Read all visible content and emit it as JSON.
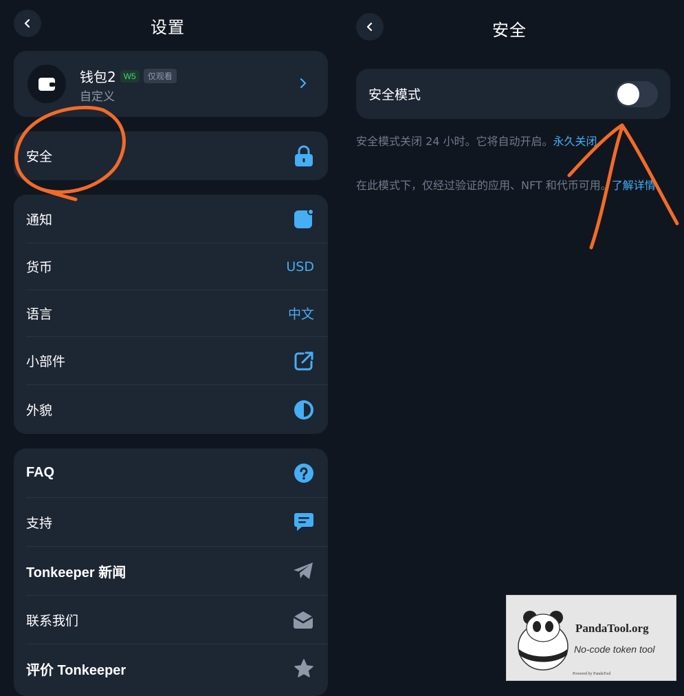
{
  "settings": {
    "title": "设置",
    "wallet": {
      "name": "钱包2",
      "badge_version": "W5",
      "badge_mode": "仅观看",
      "subtitle": "自定义"
    },
    "security_label": "安全",
    "group1": [
      {
        "label": "通知",
        "icon": "notification-icon"
      },
      {
        "label": "货币",
        "value": "USD"
      },
      {
        "label": "语言",
        "value": "中文"
      },
      {
        "label": "小部件",
        "icon": "external-link-icon"
      },
      {
        "label": "外貌",
        "icon": "contrast-icon"
      }
    ],
    "group2": [
      {
        "label": "FAQ",
        "icon": "question-icon"
      },
      {
        "label": "支持",
        "icon": "chat-icon"
      },
      {
        "label": "Tonkeeper 新闻",
        "icon": "telegram-icon"
      },
      {
        "label": "联系我们",
        "icon": "mail-icon"
      },
      {
        "label": "评价 Tonkeeper",
        "icon": "star-icon"
      }
    ]
  },
  "security": {
    "title": "安全",
    "safe_mode_label": "安全模式",
    "safe_mode_on": false,
    "desc1_text": "安全模式关闭 24 小时。它将自动开启。",
    "desc1_link": "永久关闭",
    "desc2_text": "在此模式下，仅经过验证的应用、NFT 和代币可用。",
    "desc2_link": "了解详情"
  },
  "watermark": {
    "title": "PandaTool.org",
    "subtitle": "No-code token tool",
    "small": "Powered by PandaTool"
  },
  "colors": {
    "background": "#10161f",
    "card": "#1d2633",
    "accent": "#45aef5",
    "annotation": "#f26b2a"
  }
}
